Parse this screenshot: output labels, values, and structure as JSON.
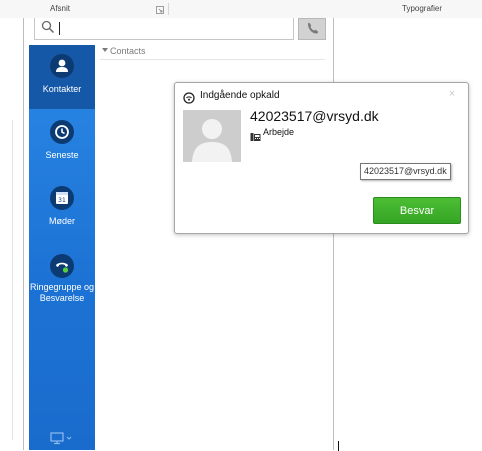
{
  "ribbon": {
    "section_label": "Afsnit",
    "styles_label": "Typografier"
  },
  "jabber": {
    "search": {
      "value": "",
      "icon": "search-icon"
    },
    "call_button_icon": "phone-icon",
    "nav": {
      "items": [
        {
          "label": "Kontakter",
          "icon": "person-icon",
          "active": true
        },
        {
          "label": "Seneste",
          "icon": "clock-icon",
          "active": false
        },
        {
          "label": "Møder",
          "icon": "calendar-icon",
          "calendar_day": "31",
          "active": false
        },
        {
          "label": "Ringegruppe og Besvarelse",
          "icon": "hunt-group-icon",
          "active": false
        }
      ],
      "footer_icon": "monitor-icon"
    },
    "contacts_group": "Contacts"
  },
  "incoming_call": {
    "title": "Indgående opkald",
    "caller": "42023517@vrsyd.dk",
    "caller_type": "Arbejde",
    "tooltip": "42023517@vrsyd.dk",
    "answer_label": "Besvar",
    "close_symbol": "×"
  },
  "colors": {
    "nav_blue": "#1c72d4",
    "nav_active": "#1558a8",
    "icon_circle": "#0c3b74",
    "answer_green": "#3aab28",
    "presence_green": "#5ad13b"
  }
}
